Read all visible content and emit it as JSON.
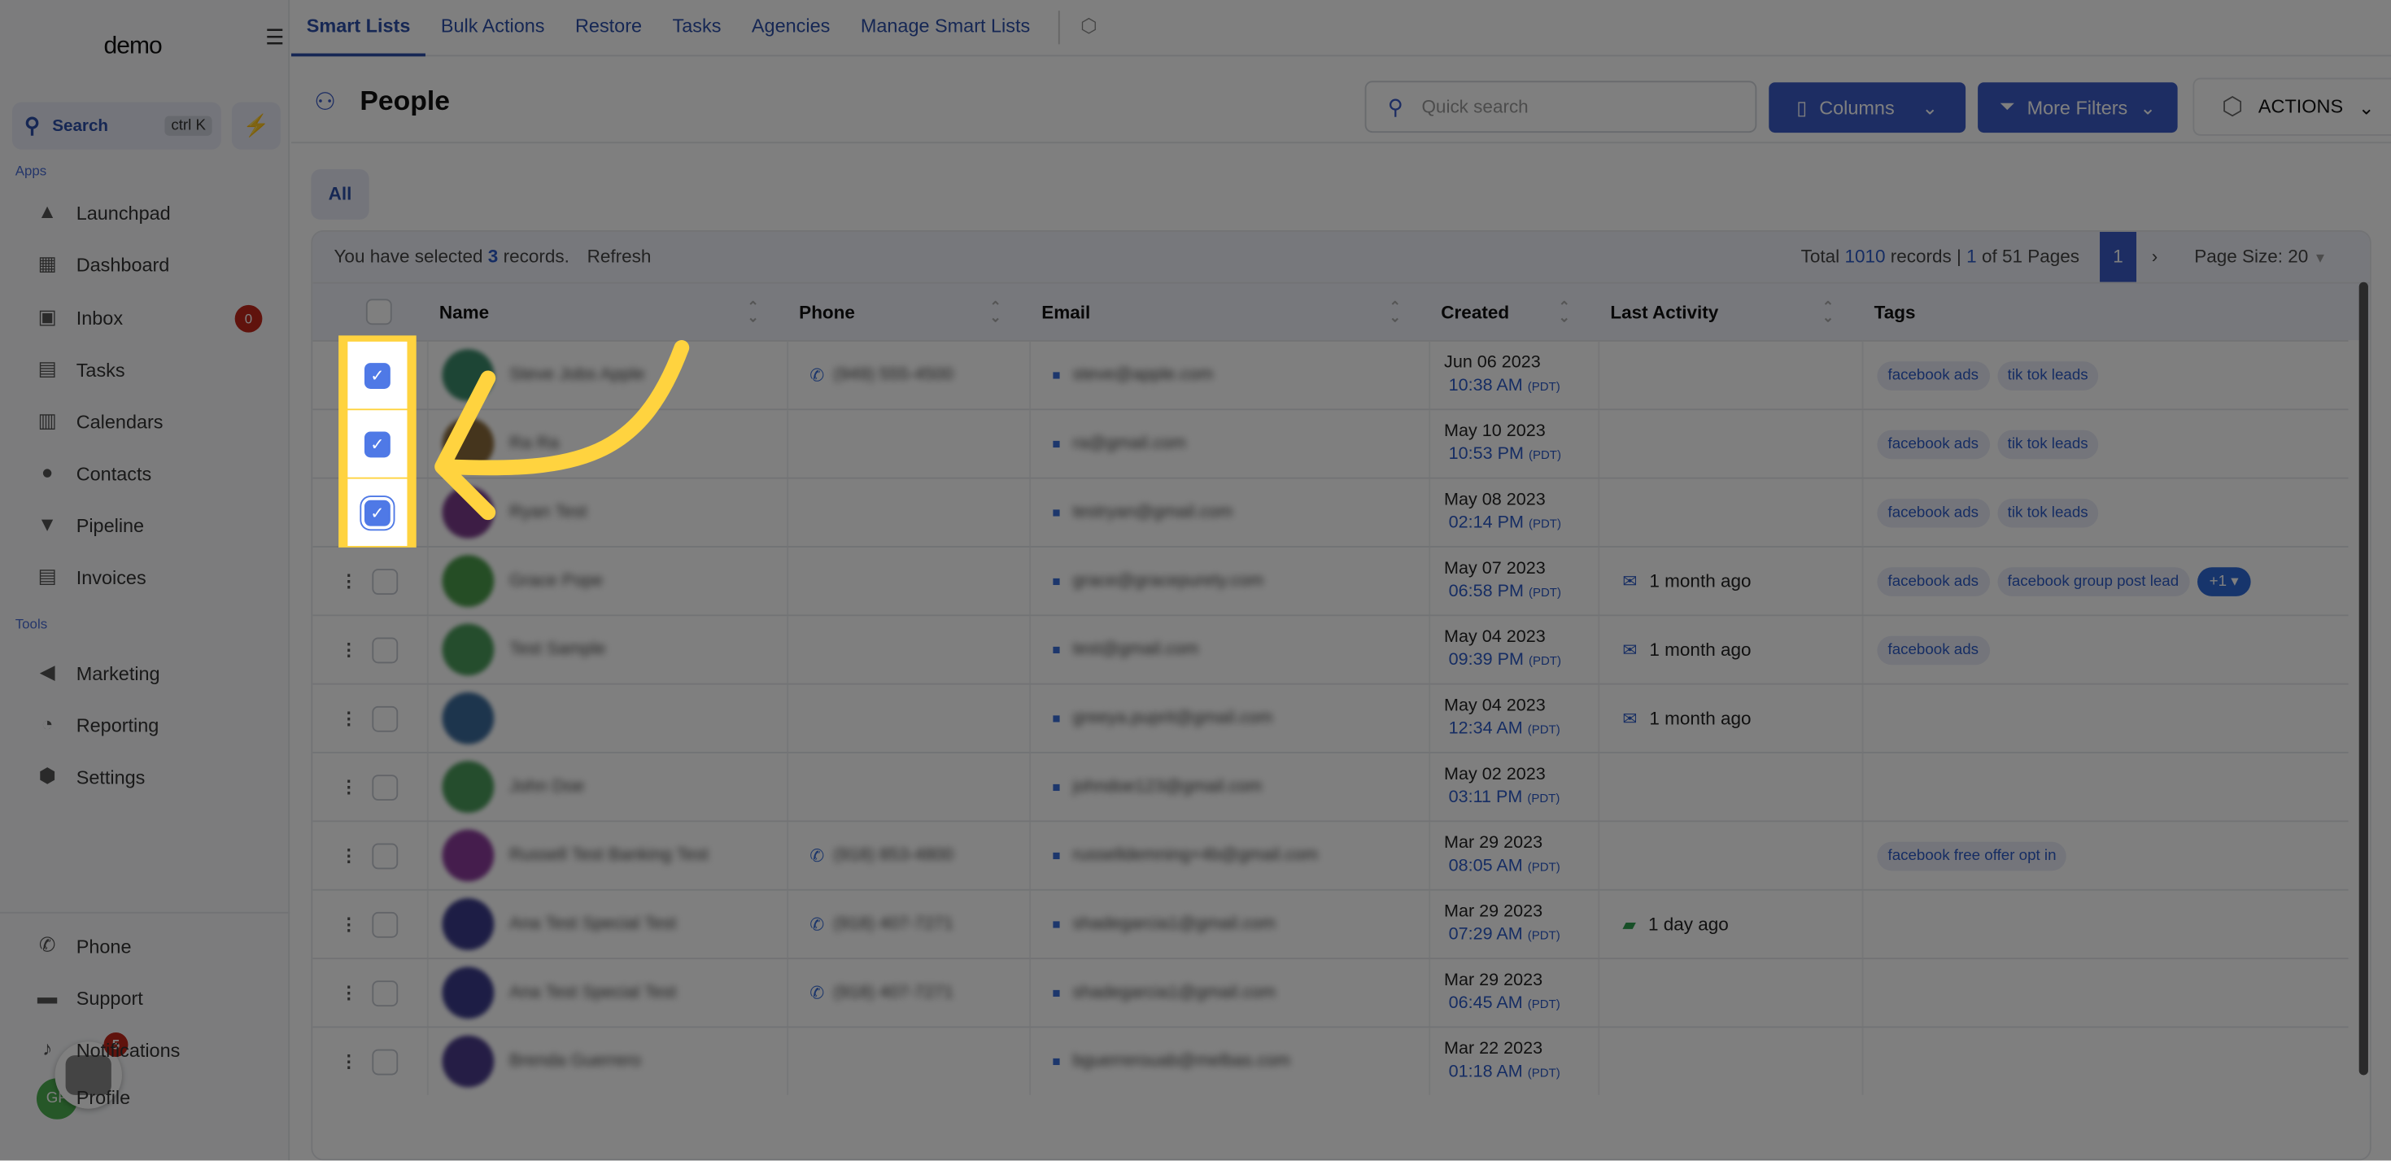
{
  "sidebar": {
    "logo": "demo",
    "search_label": "Search",
    "search_shortcut": "ctrl K",
    "apps_label": "Apps",
    "tools_label": "Tools",
    "apps": [
      {
        "label": "Launchpad",
        "icon": "rocket-icon"
      },
      {
        "label": "Dashboard",
        "icon": "grid-icon"
      },
      {
        "label": "Inbox",
        "icon": "inbox-icon",
        "badge": "0"
      },
      {
        "label": "Tasks",
        "icon": "clipboard-icon"
      },
      {
        "label": "Calendars",
        "icon": "calendar-icon"
      },
      {
        "label": "Contacts",
        "icon": "person-icon"
      },
      {
        "label": "Pipeline",
        "icon": "funnel-icon"
      },
      {
        "label": "Invoices",
        "icon": "invoice-icon"
      }
    ],
    "tools": [
      {
        "label": "Marketing",
        "icon": "megaphone-icon"
      },
      {
        "label": "Reporting",
        "icon": "pie-chart-icon"
      },
      {
        "label": "Settings",
        "icon": "gear-icon"
      }
    ],
    "bottom": [
      {
        "label": "Phone",
        "icon": "phone-icon"
      },
      {
        "label": "Support",
        "icon": "chat-icon"
      },
      {
        "label": "Notifications",
        "icon": "bell-icon"
      },
      {
        "label": "Profile",
        "icon": "avatar"
      }
    ],
    "avatar_initials": "GP",
    "chat_widget_badge": "5"
  },
  "topnav": {
    "tabs": [
      "Smart Lists",
      "Bulk Actions",
      "Restore",
      "Tasks",
      "Agencies",
      "Manage Smart Lists"
    ],
    "active": 0
  },
  "header": {
    "title": "People",
    "search_placeholder": "Quick search",
    "columns_label": "Columns",
    "filters_label": "More Filters",
    "actions_label": "ACTIONS"
  },
  "filter_tab": "All",
  "toolbar": {
    "selected_prefix": "You have selected",
    "selected_count": "3",
    "selected_suffix": "records.",
    "refresh": "Refresh",
    "total_prefix": "Total",
    "total": "1010",
    "total_mid": "records |",
    "page": "1",
    "pages_suffix": "of 51 Pages",
    "current_page": "1",
    "page_size": "Page Size: 20"
  },
  "columns": [
    "Name",
    "Phone",
    "Email",
    "Created",
    "Last Activity",
    "Tags"
  ],
  "rows": [
    {
      "checked": true,
      "name": "Steve Jobs Apple",
      "avatar_color": "#3b8a6a",
      "phone": "(949) 555-4500",
      "email": "steve@apple.com",
      "date": "Jun 06 2023",
      "time": "10:38 AM",
      "tz": "(PDT)",
      "activity": "",
      "activity_icon": "",
      "tags": [
        "facebook ads",
        "tik tok leads"
      ],
      "more": ""
    },
    {
      "checked": true,
      "name": "Ra Ra",
      "avatar_color": "#8a6a3b",
      "phone": "",
      "email": "ra@gmail.com",
      "date": "May 10 2023",
      "time": "10:53 PM",
      "tz": "(PDT)",
      "activity": "",
      "activity_icon": "",
      "tags": [
        "facebook ads",
        "tik tok leads"
      ],
      "more": ""
    },
    {
      "checked": true,
      "name": "Ryan Test",
      "avatar_color": "#7a3b8a",
      "phone": "",
      "email": "testryan@gmail.com",
      "date": "May 08 2023",
      "time": "02:14 PM",
      "tz": "(PDT)",
      "activity": "",
      "activity_icon": "",
      "tags": [
        "facebook ads",
        "tik tok leads"
      ],
      "more": ""
    },
    {
      "checked": false,
      "name": "Grace Pope",
      "avatar_color": "#4a9a4a",
      "phone": "",
      "email": "grace@gracepurety.com",
      "date": "May 07 2023",
      "time": "06:58 PM",
      "tz": "(PDT)",
      "activity": "1 month ago",
      "activity_icon": "email",
      "tags": [
        "facebook ads",
        "facebook group post lead"
      ],
      "more": "+1"
    },
    {
      "checked": false,
      "name": "Test Sample",
      "avatar_color": "#4a9a5a",
      "phone": "",
      "email": "test@gmail.com",
      "date": "May 04 2023",
      "time": "09:39 PM",
      "tz": "(PDT)",
      "activity": "1 month ago",
      "activity_icon": "email",
      "tags": [
        "facebook ads"
      ],
      "more": ""
    },
    {
      "checked": false,
      "name": "",
      "avatar_color": "#3b6a9a",
      "phone": "",
      "email": "greeya.puprit@gmail.com",
      "date": "May 04 2023",
      "time": "12:34 AM",
      "tz": "(PDT)",
      "activity": "1 month ago",
      "activity_icon": "email",
      "tags": [],
      "more": ""
    },
    {
      "checked": false,
      "name": "John Doe",
      "avatar_color": "#4a9a5a",
      "phone": "",
      "email": "johndoe123@gmail.com",
      "date": "May 02 2023",
      "time": "03:11 PM",
      "tz": "(PDT)",
      "activity": "",
      "activity_icon": "",
      "tags": [],
      "more": ""
    },
    {
      "checked": false,
      "name": "Russell Test Banking Test",
      "avatar_color": "#8a3b9a",
      "phone": "(918) 853-4800",
      "email": "russelldemning+4b@gmail.com",
      "date": "Mar 29 2023",
      "time": "08:05 AM",
      "tz": "(PDT)",
      "activity": "",
      "activity_icon": "",
      "tags": [
        "facebook free offer opt in"
      ],
      "more": ""
    },
    {
      "checked": false,
      "name": "Ana Test Special Test",
      "avatar_color": "#3b3b8a",
      "phone": "(918) 407-7271",
      "email": "shadegarcia1@gmail.com",
      "date": "Mar 29 2023",
      "time": "07:29 AM",
      "tz": "(PDT)",
      "activity": "1 day ago",
      "activity_icon": "sms",
      "tags": [],
      "more": ""
    },
    {
      "checked": false,
      "name": "Ana Test Special Test",
      "avatar_color": "#3b3b8a",
      "phone": "(918) 407-7271",
      "email": "shadegarcia1@gmail.com",
      "date": "Mar 29 2023",
      "time": "06:45 AM",
      "tz": "(PDT)",
      "activity": "",
      "activity_icon": "",
      "tags": [],
      "more": ""
    },
    {
      "checked": false,
      "name": "Brenda Guerrero",
      "avatar_color": "#4a3b8a",
      "phone": "",
      "email": "bguerrerouab@melbas.com",
      "date": "Mar 22 2023",
      "time": "01:18 AM",
      "tz": "(PDT)",
      "activity": "",
      "activity_icon": "",
      "tags": [],
      "more": ""
    }
  ],
  "colors": {
    "accent": "#3a5bc7",
    "highlight": "#ffd33f",
    "checkbox": "#4f79e6"
  }
}
